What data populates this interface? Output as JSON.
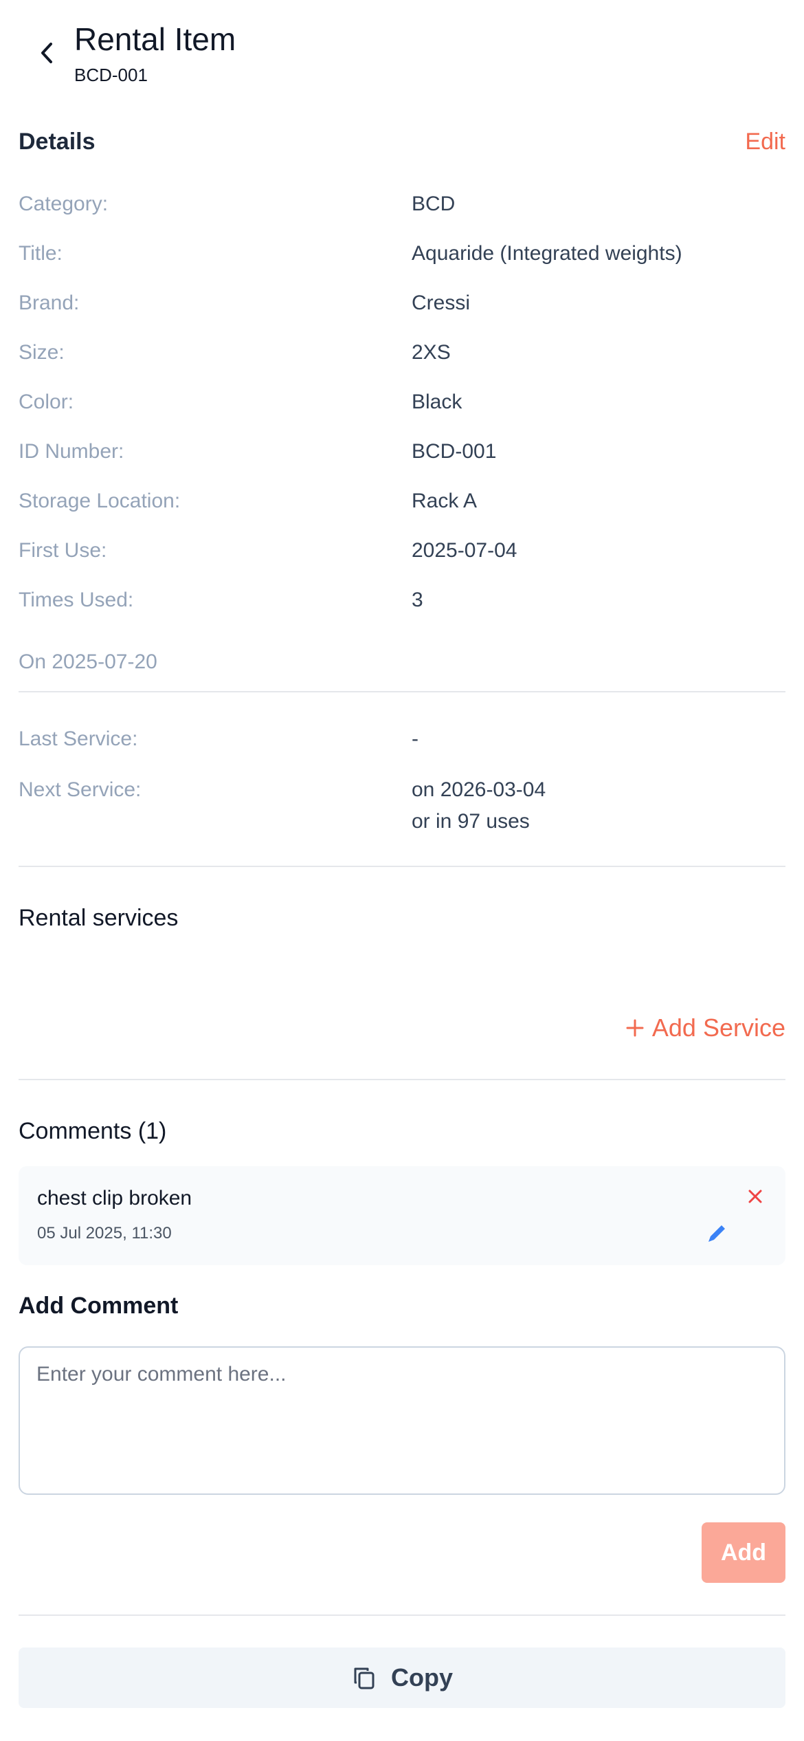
{
  "header": {
    "title": "Rental Item",
    "subtitle": "BCD-001"
  },
  "details": {
    "section_title": "Details",
    "edit_label": "Edit",
    "rows": [
      {
        "label": "Category:",
        "value": "BCD"
      },
      {
        "label": "Title:",
        "value": "Aquaride (Integrated weights)"
      },
      {
        "label": "Brand:",
        "value": "Cressi"
      },
      {
        "label": "Size:",
        "value": "2XS"
      },
      {
        "label": "Color:",
        "value": "Black"
      },
      {
        "label": "ID Number:",
        "value": "BCD-001"
      },
      {
        "label": "Storage Location:",
        "value": "Rack A"
      },
      {
        "label": "First Use:",
        "value": "2025-07-04"
      },
      {
        "label": "Times Used:",
        "value": "3"
      }
    ],
    "on_date": "On 2025-07-20"
  },
  "service": {
    "last_label": "Last Service:",
    "last_value": "-",
    "next_label": "Next Service:",
    "next_value_line1": "on 2026-03-04",
    "next_value_line2": "or in 97 uses"
  },
  "rental_services": {
    "title": "Rental services",
    "add_label": "Add Service"
  },
  "comments": {
    "title": "Comments (1)",
    "items": [
      {
        "text": "chest clip broken",
        "date": "05 Jul 2025, 11:30"
      }
    ],
    "add_title": "Add Comment",
    "input_placeholder": "Enter your comment here...",
    "add_button": "Add"
  },
  "actions": {
    "copy_label": "Copy"
  },
  "colors": {
    "accent": "#f26a4f",
    "accent_disabled": "#fba898",
    "delete": "#ef4444",
    "edit_icon": "#3b82f6"
  },
  "icons": [
    "chevron-left-icon",
    "plus-icon",
    "close-icon",
    "pencil-icon",
    "copy-icon"
  ]
}
